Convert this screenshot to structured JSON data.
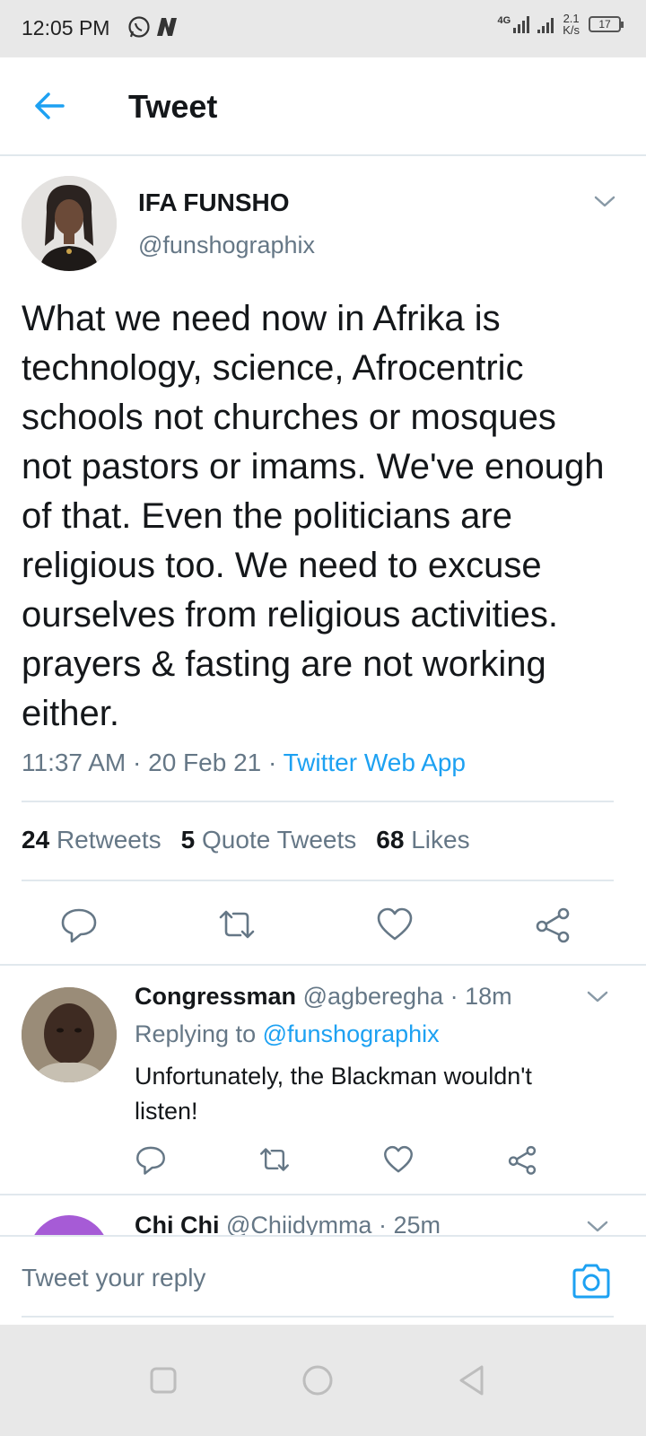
{
  "status_bar": {
    "time": "12:05 PM",
    "network": "4G",
    "speed_value": "2.1",
    "speed_unit": "K/s",
    "battery": "17",
    "icons": [
      "whatsapp-icon",
      "n-app-icon",
      "signal-icon",
      "battery-icon"
    ]
  },
  "header": {
    "title": "Tweet",
    "back_icon": "back-arrow-icon"
  },
  "tweet": {
    "author_name": "IFA FUNSHO",
    "author_handle": "@funshographix",
    "text": "What we need now in Afrika is technology, science, Afrocentric schools not churches or mosques not pastors or imams. We've enough of that. Even the politicians are religious too. We need to excuse ourselves from religious activities. prayers & fasting are not working either.",
    "time": "11:37 AM",
    "date": "20 Feb 21",
    "source": "Twitter Web App",
    "separator": "·",
    "stats": {
      "retweets_count": "24",
      "retweets_label": "Retweets",
      "quotes_count": "5",
      "quotes_label": "Quote Tweets",
      "likes_count": "68",
      "likes_label": "Likes"
    }
  },
  "replies": [
    {
      "name": "Congressman",
      "handle": "@agberegha",
      "time": "18m",
      "replying_label": "Replying to",
      "replying_to": "@funshographix",
      "text": "Unfortunately, the Blackman wouldn't listen!"
    },
    {
      "name": "Chi Chi",
      "handle": "@Chiidymma",
      "time": "25m"
    }
  ],
  "compose": {
    "placeholder": "Tweet your reply"
  },
  "colors": {
    "accent": "#1da1f2",
    "secondary_text": "#657786",
    "primary_text": "#14171a",
    "divider": "#e1e8ed"
  }
}
